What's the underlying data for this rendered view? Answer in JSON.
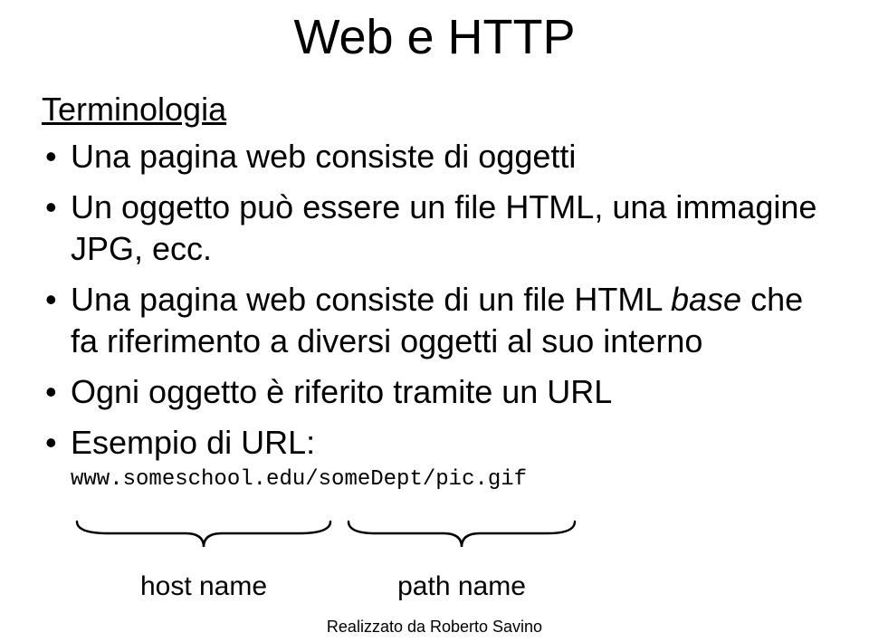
{
  "title": "Web e HTTP",
  "section_head": "Terminologia",
  "bullets": [
    {
      "pre": "Una pagina web consiste di oggetti",
      "ital": "",
      "post": ""
    },
    {
      "pre": "Un oggetto può essere un file HTML, una immagine JPG, ecc.",
      "ital": "",
      "post": ""
    },
    {
      "pre": "Una pagina web consiste di un file HTML ",
      "ital": "base",
      "post": " che fa riferimento a diversi oggetti al suo interno"
    },
    {
      "pre": "Ogni oggetto è riferito tramite un URL",
      "ital": "",
      "post": ""
    },
    {
      "pre": "Esempio di URL:",
      "ital": "",
      "post": ""
    }
  ],
  "url_example": "www.someschool.edu/someDept/pic.gif",
  "labels": {
    "host": "host name",
    "path": "path name"
  },
  "footer": "Realizzato da Roberto Savino"
}
